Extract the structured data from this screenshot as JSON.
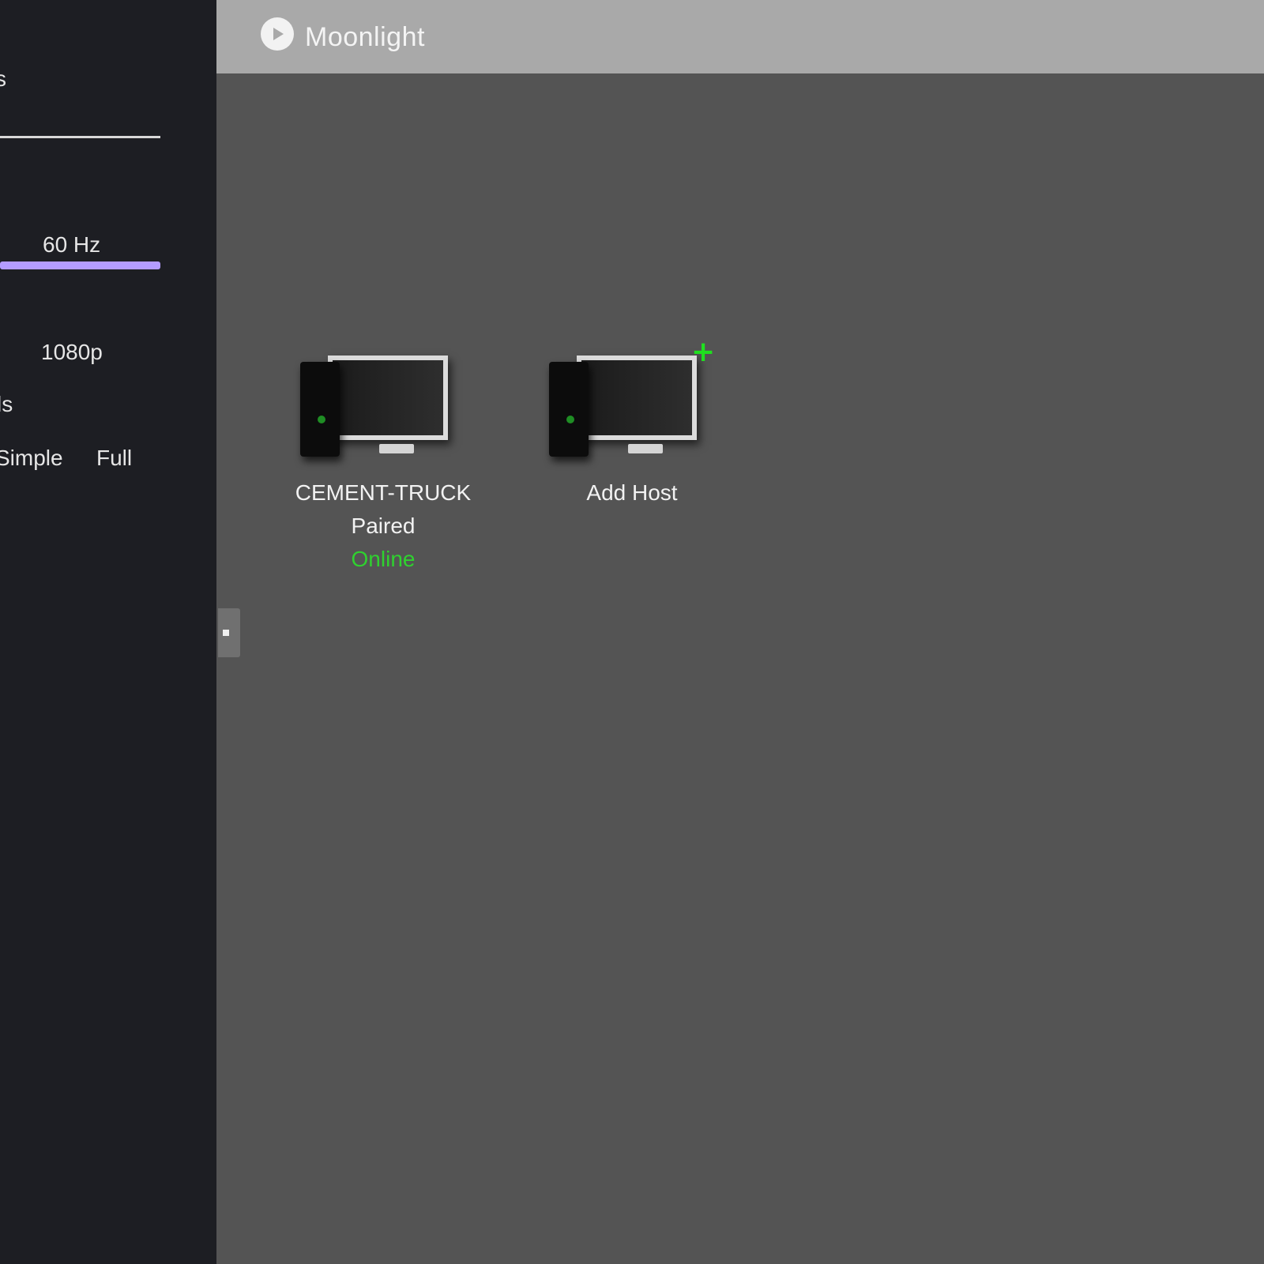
{
  "sidebar": {
    "fragment_top": "s",
    "frame_rate": "60 Hz",
    "frame_rate_level": 1.0,
    "resolution": "1080p",
    "fragment_mid": "ls",
    "options": [
      "Simple",
      "Full"
    ]
  },
  "header": {
    "title": "Moonlight"
  },
  "hosts": [
    {
      "name": "CEMENT-TRUCK",
      "pair_state": "Paired",
      "status": "Online"
    },
    {
      "name": "Add Host"
    }
  ],
  "colors": {
    "sidebar_bg": "#1d1e23",
    "header_bg": "#a9a9a9",
    "content_bg": "#545454",
    "slider_accent": "#b49cff",
    "online_green": "#2fd12f"
  },
  "icons": [
    "app-logo-icon",
    "computer-icon",
    "add-plus-icon",
    "drawer-handle-icon"
  ]
}
